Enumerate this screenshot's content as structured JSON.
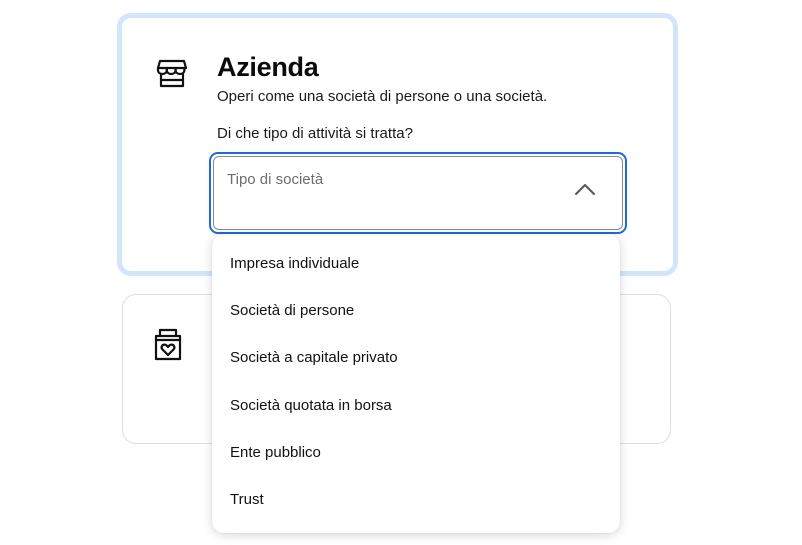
{
  "business_card": {
    "title": "Azienda",
    "description": "Operi come una società di persone o una società.",
    "field_label": "Di che tipo di attività si tratta?",
    "select": {
      "placeholder": "Tipo di società",
      "state": "open"
    },
    "icon": "store-icon"
  },
  "second_card": {
    "icon": "heart-bag-icon"
  },
  "dropdown": {
    "options": [
      "Impresa individuale",
      "Società di persone",
      "Società a capitale privato",
      "Società quotata in borsa",
      "Ente pubblico",
      "Trust"
    ]
  },
  "colors": {
    "focus_border": "#1c6bdc",
    "selected_card_border": "#d3e5fa",
    "card_border": "#dedede",
    "text": "#111111",
    "placeholder": "#6d6d6d"
  }
}
